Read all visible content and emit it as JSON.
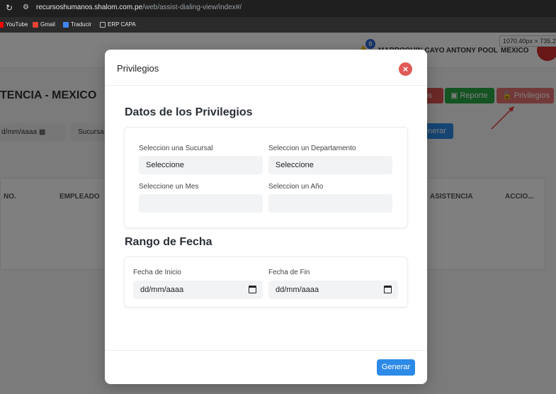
{
  "browser": {
    "reload_icon": "reload-icon",
    "url_host": "recursoshumanos.shalom.com.pe",
    "url_path": "/web/assist-dialing-view/index#/",
    "bookmarks": [
      {
        "label": "YouTube",
        "color": "#ff0000"
      },
      {
        "label": "Gmail",
        "color": "#ea4335"
      },
      {
        "label": "Traducir",
        "color": "#4285f4"
      },
      {
        "label": "ERP CAPA",
        "color": "#bdbdbd"
      }
    ]
  },
  "header": {
    "notification_count": "0",
    "user_name": "MARROQUIN CAYO ANTONY POOL",
    "country": "MEXICO",
    "dimension_tip": "1070.40px × 735.20"
  },
  "page": {
    "title": "TENCIA - MEXICO",
    "buttons": {
      "otro": "los",
      "reporte": "Reporte",
      "privilegios": "Privilegios",
      "generar": "enerar"
    },
    "filters": {
      "date": "d/mm/aaaa",
      "sucursal": "Sucursa"
    },
    "table_headers": [
      "NO.",
      "EMPLEADO",
      "ASISTENCIA",
      "ACCIO..."
    ]
  },
  "modal": {
    "title": "Privilegios",
    "section_privileges": "Datos de los Privilegios",
    "fields": {
      "sucursal_label": "Seleccion una Sucursal",
      "sucursal_value": "Seleccione",
      "departamento_label": "Seleccion un Departamento",
      "departamento_value": "Seleccione",
      "mes_label": "Seleccione un Mes",
      "mes_value": "",
      "anio_label": "Seleccion un Año",
      "anio_value": ""
    },
    "section_range": "Rango de Fecha",
    "dates": {
      "start_label": "Fecha de Inicio",
      "start_value": "dd/mm/aaaa",
      "end_label": "Fecha de Fin",
      "end_value": "dd/mm/aaaa"
    },
    "generate_label": "Generar"
  },
  "colors": {
    "primary": "#2d8ae6",
    "close": "#e05a57",
    "success": "#28a745",
    "danger": "#e57373"
  }
}
